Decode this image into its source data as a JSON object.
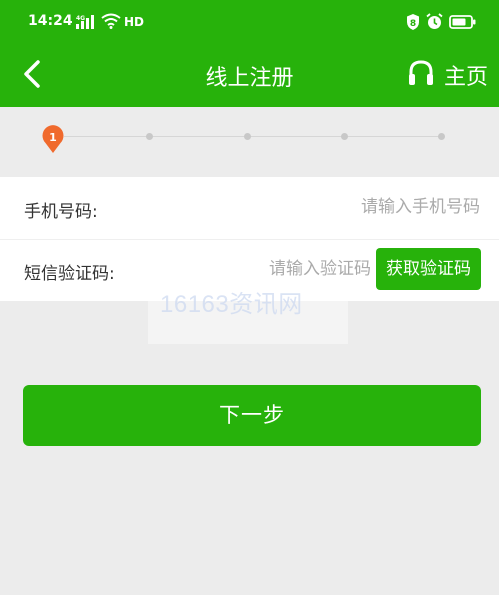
{
  "status_bar": {
    "time": "14:24",
    "network": "HD",
    "icons": [
      "signal-icon",
      "wifi-icon",
      "shield-icon",
      "alarm-icon",
      "battery-icon"
    ]
  },
  "nav": {
    "title": "线上注册",
    "back_icon": "back-arrow-icon",
    "home_icon": "headphone-icon",
    "home_label": "主页"
  },
  "stepper": {
    "current_step": "1",
    "total_steps": 5
  },
  "form": {
    "phone": {
      "label": "手机号码:",
      "value": "",
      "placeholder": "请输入手机号码"
    },
    "sms": {
      "label": "短信验证码:",
      "value": "",
      "placeholder": "请输入验证码",
      "button_label": "获取验证码"
    }
  },
  "watermark": "16163资讯网",
  "next_button_label": "下一步",
  "colors": {
    "brand": "#27b20b",
    "background": "#ececec",
    "step_active": "#f06a2d"
  }
}
